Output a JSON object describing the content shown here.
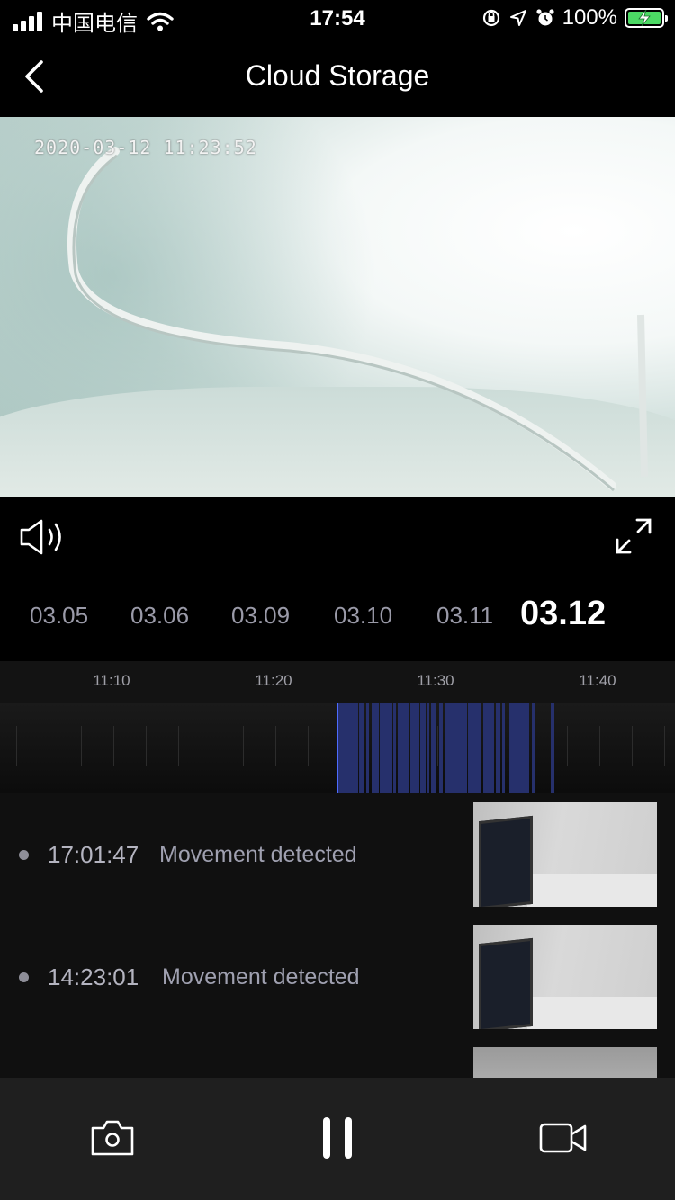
{
  "status_bar": {
    "carrier": "中国电信",
    "time": "17:54",
    "battery_percent": "100%",
    "signal_bars": 4
  },
  "nav": {
    "title": "Cloud Storage",
    "back_icon": "chevron-left-icon"
  },
  "video": {
    "timestamp": "2020-03-12  11:23:52"
  },
  "player_controls": {
    "volume_icon": "speaker-icon",
    "fullscreen_icon": "expand-icon"
  },
  "dates": [
    {
      "label": "03.05",
      "active": false
    },
    {
      "label": "03.06",
      "active": false
    },
    {
      "label": "03.09",
      "active": false
    },
    {
      "label": "03.10",
      "active": false
    },
    {
      "label": "03.11",
      "active": false
    },
    {
      "label": "03.12",
      "active": true
    }
  ],
  "timeline": {
    "ticks": [
      "11:10",
      "11:20",
      "11:30",
      "11:40"
    ],
    "playhead_time": "11:23:52"
  },
  "events": [
    {
      "time": "17:01:47",
      "description": "Movement detected"
    },
    {
      "time": "14:23:01",
      "description": "Movement detected"
    }
  ],
  "toolbar": {
    "snapshot_icon": "camera-icon",
    "pause_icon": "pause-icon",
    "record_icon": "video-camera-icon"
  },
  "colors": {
    "background": "#000000",
    "timeline_recording": "#26306c",
    "playhead": "#4d6bff",
    "battery": "#4cd964"
  }
}
